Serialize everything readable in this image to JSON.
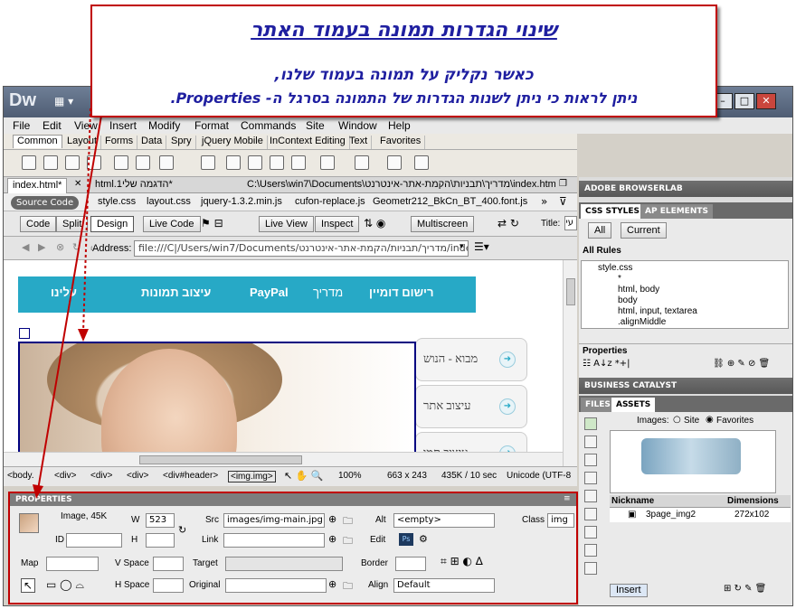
{
  "annotation": {
    "title": "שינוי הגדרות תמונה בעמוד האתר",
    "line1": "כאשר נקליק על תמונה בעמוד שלנו,",
    "line2": "ניתן לראות כי ניתן לשנות הגדרות של התמונה בסרגל ה- Properties."
  },
  "app": {
    "logo": "Dw",
    "menu": [
      "File",
      "Edit",
      "View",
      "Insert",
      "Modify",
      "Format",
      "Commands",
      "Site",
      "Window",
      "Help"
    ]
  },
  "insert_tabs": [
    "Common",
    "Layout",
    "Forms",
    "Data",
    "Spry",
    "jQuery Mobile",
    "InContext Editing",
    "Text",
    "Favorites"
  ],
  "doc_tabs": {
    "tab1": "index.html*",
    "tab2": "*הדגמה שלי1.html",
    "path": "C:\\Users\\win7\\Documents\\מדריך\\תבניות\\הקמת-אתר-אינטרנט\\index.html"
  },
  "related_files": {
    "source": "Source Code",
    "files": [
      "style.css",
      "layout.css",
      "jquery-1.3.2.min.js",
      "cufon-replace.js",
      "Geometr212_BkCn_BT_400.font.js"
    ]
  },
  "view_toolbar": {
    "code": "Code",
    "split": "Split",
    "design": "Design",
    "live_code": "Live Code",
    "live_view": "Live View",
    "inspect": "Inspect",
    "multiscreen": "Multiscreen",
    "title_label": "Title:",
    "title_value": "עי"
  },
  "address_bar": {
    "label": "Address:",
    "value": "file:///C|/Users/win7/Documents/מדריך/תבניות/הקמת-אתר-אינטרנט/index.h"
  },
  "page": {
    "nav": [
      "רישום דומיין",
      "מדריך",
      "PayPal",
      "עיצוב תמונות",
      "עלינו"
    ],
    "side": [
      "מבוא - הנוש",
      "עיצוב אתר",
      "עיצוב תמו"
    ]
  },
  "tag_selector": {
    "tags": [
      "<body.",
      "<div>",
      "<div>",
      "<div>",
      "<div#header>",
      "<img.img>"
    ],
    "zoom": "100%",
    "size": "663 x 243",
    "download": "435K / 10 sec",
    "encoding": "Unicode (UTF-8"
  },
  "properties": {
    "header": "PROPERTIES",
    "image_label": "Image, 45K",
    "w_label": "W",
    "w_value": "523",
    "h_label": "H",
    "h_value": "",
    "id_label": "ID",
    "id_value": "",
    "src_label": "Src",
    "src_value": "images/img-main.jpg",
    "link_label": "Link",
    "link_value": "",
    "alt_label": "Alt",
    "alt_value": "<empty>",
    "edit_label": "Edit",
    "class_label": "Class",
    "class_value": "img",
    "map_label": "Map",
    "map_value": "",
    "vspace_label": "V Space",
    "hspace_label": "H Space",
    "target_label": "Target",
    "border_label": "Border",
    "original_label": "Original",
    "align_label": "Align",
    "align_value": "Default"
  },
  "right_panel": {
    "browserlab": "ADOBE BROWSERLAB",
    "css_styles_tab": "CSS STYLES",
    "ap_elements_tab": "AP ELEMENTS",
    "all_btn": "All",
    "current_btn": "Current",
    "all_rules": "All Rules",
    "tree_root": "style.css",
    "tree_items": [
      "*",
      "html, body",
      "body",
      "html, input, textarea",
      ".alignMiddle"
    ],
    "properties_label": "Properties",
    "business_catalyst": "BUSINESS CATALYST",
    "files_tab": "FILES",
    "assets_tab": "ASSETS",
    "images_label": "Images:",
    "site_radio": "Site",
    "favorites_radio": "Favorites",
    "nickname_col": "Nickname",
    "dimensions_col": "Dimensions",
    "asset_name": "3page_img2",
    "asset_dim": "272x102",
    "insert_btn": "Insert"
  },
  "colors": {
    "annotation_border": "#c00000",
    "annotation_text": "#1f1fa0",
    "nav_bg": "#27a9c6"
  }
}
